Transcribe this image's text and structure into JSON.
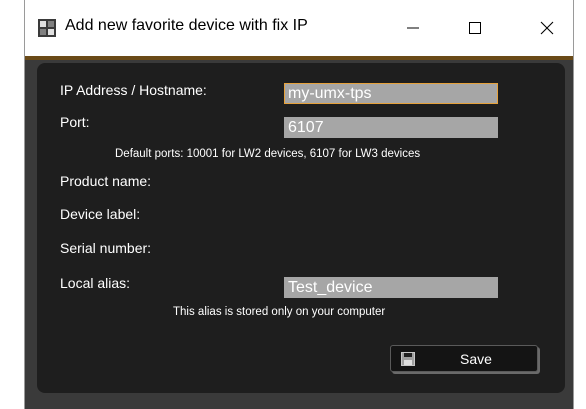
{
  "window": {
    "title": "Add new favorite device with fix IP",
    "controls": {
      "minimize": "minimize",
      "maximize": "maximize",
      "close": "close"
    }
  },
  "form": {
    "ip_label": "IP Address / Hostname:",
    "ip_value": "my-umx-tps",
    "port_label": "Port:",
    "port_value": "6107",
    "port_hint": "Default ports: 10001 for LW2 devices, 6107 for LW3 devices",
    "product_name_label": "Product name:",
    "device_label_label": "Device label:",
    "serial_number_label": "Serial number:",
    "local_alias_label": "Local alias:",
    "local_alias_value": "Test_device",
    "alias_hint": "This alias is stored only on your computer"
  },
  "actions": {
    "save_label": "Save"
  },
  "colors": {
    "panel": "#1e1e1e",
    "field": "#a6a6a6",
    "focus_border": "#e6a23c",
    "accent_strip": "#6a4a18"
  },
  "icons": {
    "app": "app-grid-icon",
    "save": "floppy-disk-icon"
  }
}
